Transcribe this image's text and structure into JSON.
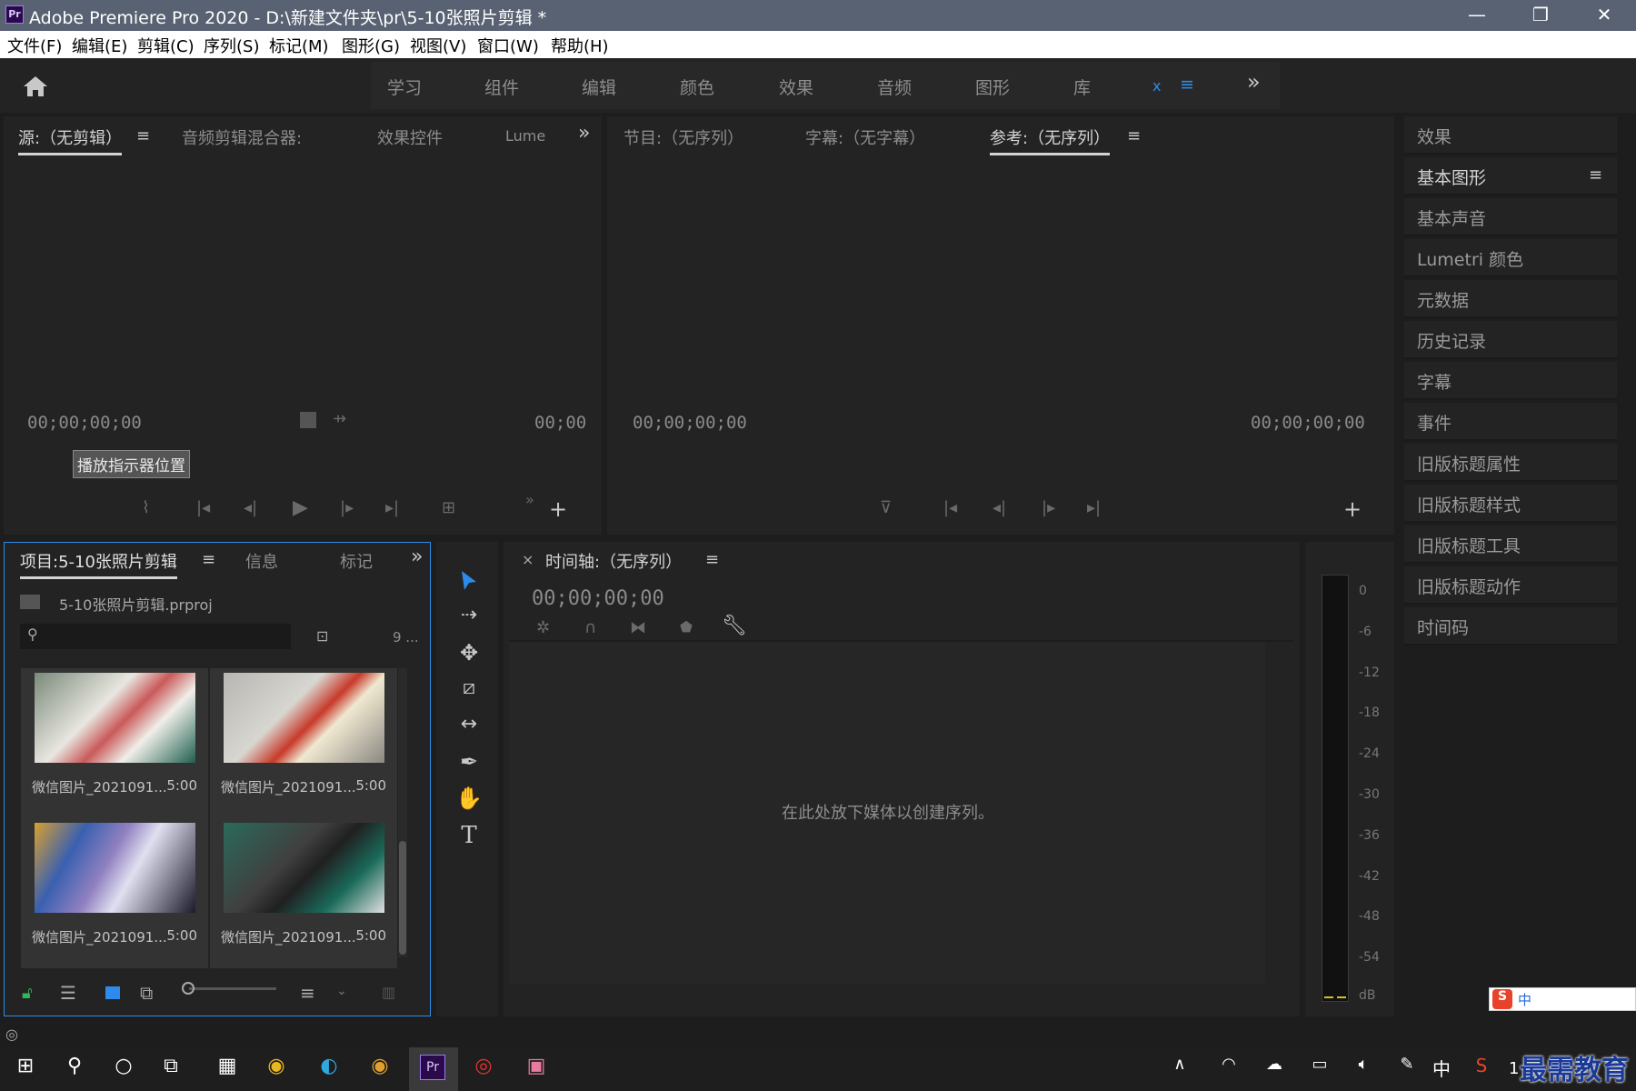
{
  "window": {
    "title": "Adobe Premiere Pro 2020 - D:\\新建文件夹\\pr\\5-10张照片剪辑 *",
    "app_badge": "Pr",
    "minimize": "—",
    "maximize": "❐",
    "close": "✕"
  },
  "menu": [
    "文件(F)",
    "编辑(E)",
    "剪辑(C)",
    "序列(S)",
    "标记(M)",
    "图形(G)",
    "视图(V)",
    "窗口(W)",
    "帮助(H)"
  ],
  "workspaces": [
    "学习",
    "组件",
    "编辑",
    "颜色",
    "效果",
    "音频",
    "图形",
    "库"
  ],
  "workspace_extra": {
    "x": "x",
    "menu": "≡",
    "more": "»"
  },
  "source_panel": {
    "tabs": [
      "源:（无剪辑）",
      "音频剪辑混合器:",
      "效果控件",
      "Lume"
    ],
    "timecode_left": "00;00;00;00",
    "timecode_right": "00;00",
    "tooltip": "播放指示器位置",
    "more": "»"
  },
  "program_panel": {
    "tabs": [
      "节目:（无序列）",
      "字幕:（无字幕）",
      "参考:（无序列）"
    ],
    "timecode_left": "00;00;00;00",
    "timecode_right": "00;00;00;00"
  },
  "right_panel": {
    "items": [
      "效果",
      "基本图形",
      "基本声音",
      "Lumetri 颜色",
      "元数据",
      "历史记录",
      "字幕",
      "事件",
      "旧版标题属性",
      "旧版标题样式",
      "旧版标题工具",
      "旧版标题动作",
      "时间码"
    ]
  },
  "project_panel": {
    "tabs": [
      "项目:5-10张照片剪辑",
      "信息",
      "标记"
    ],
    "file": "5-10张照片剪辑.prproj",
    "count": "9 ...",
    "items": [
      {
        "name": "微信图片_2021091...",
        "duration": "5:00"
      },
      {
        "name": "微信图片_2021091...",
        "duration": "5:00"
      },
      {
        "name": "微信图片_2021091...",
        "duration": "5:00"
      },
      {
        "name": "微信图片_2021091...",
        "duration": "5:00"
      }
    ]
  },
  "timeline_panel": {
    "close": "×",
    "title": "时间轴:（无序列）",
    "timecode": "00;00;00;00",
    "drop_message": "在此处放下媒体以创建序列。"
  },
  "audio_meter": {
    "labels": [
      "0",
      "-6",
      "-12",
      "-18",
      "-24",
      "-30",
      "-36",
      "-42",
      "-48",
      "-54",
      "dB"
    ]
  },
  "taskbar": {
    "clock": "1",
    "ime": "中",
    "watermark": "最需教育"
  },
  "colors": {
    "accent_blue": "#2d8ceb",
    "title_bar": "#596273",
    "panel": "#232323"
  }
}
